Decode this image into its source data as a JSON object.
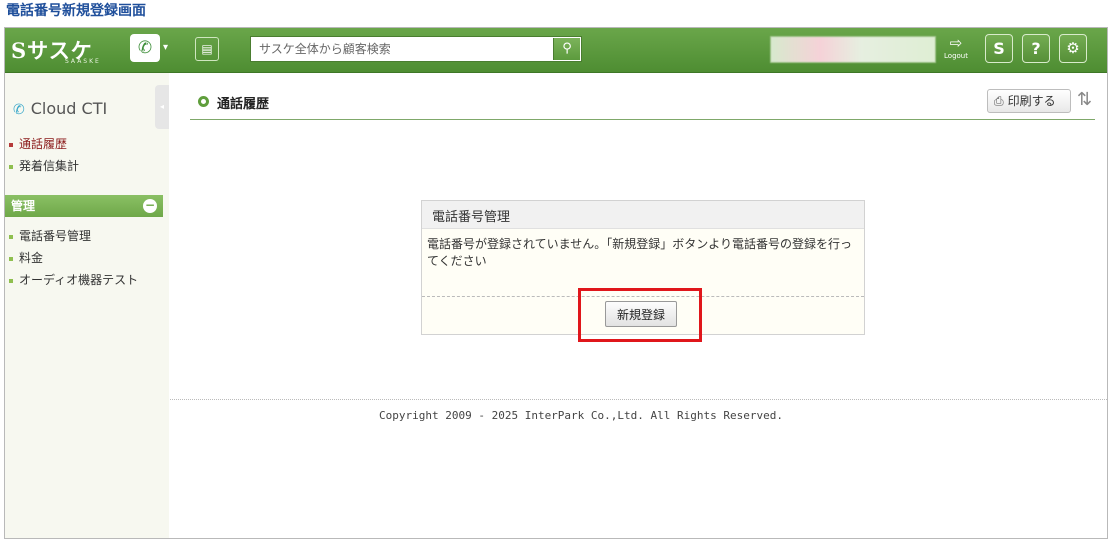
{
  "caption": "電話番号新規登録画面",
  "header": {
    "logo_text": "Sサスケ",
    "logo_sub": "SAASKE",
    "search_placeholder": "サスケ全体から顧客検索",
    "logout_label": "Logout",
    "help_label": "?",
    "s_label": "S"
  },
  "sidebar": {
    "app_title": "Cloud CTI",
    "items": [
      {
        "label": "通話履歴",
        "active": true
      },
      {
        "label": "発着信集計",
        "active": false
      }
    ],
    "section_title": "管理",
    "section_items": [
      {
        "label": "電話番号管理"
      },
      {
        "label": "料金"
      },
      {
        "label": "オーディオ機器テスト"
      }
    ]
  },
  "main": {
    "page_title": "通話履歴",
    "print_label": "印刷する",
    "panel": {
      "title": "電話番号管理",
      "message": "電話番号が登録されていません。「新規登録」ボタンより電話番号の登録を行ってください",
      "button_label": "新規登録"
    },
    "copyright": "Copyright 2009 - 2025 InterPark Co.,Ltd. All Rights Reserved."
  },
  "colors": {
    "header_green": "#5a9a3c",
    "highlight_red": "#e0161b",
    "active_nav": "#8b1a1a"
  }
}
